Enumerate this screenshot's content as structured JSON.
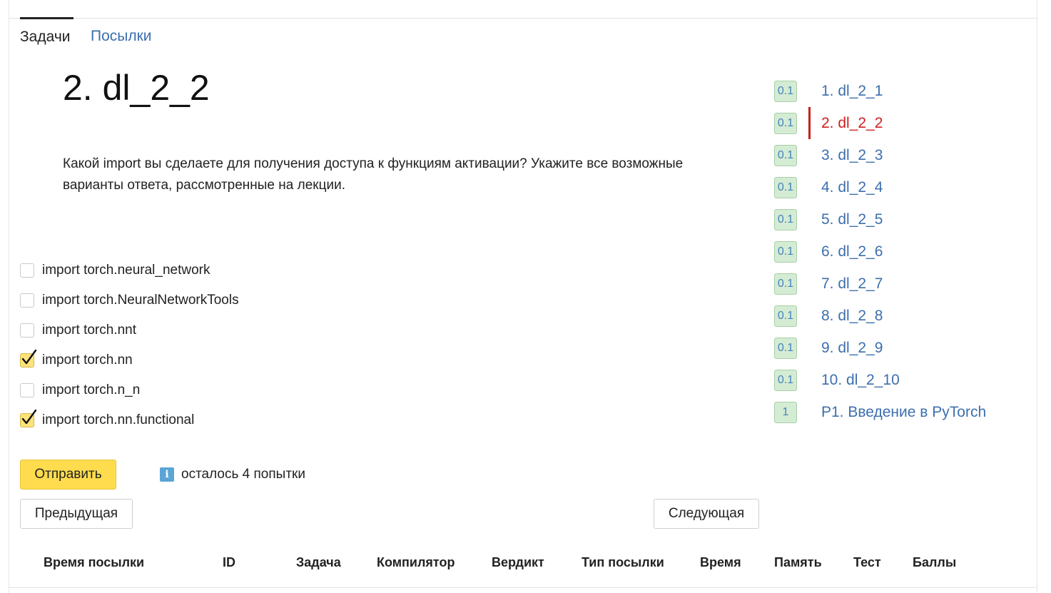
{
  "tabs": {
    "tasks": "Задачи",
    "submissions": "Посылки"
  },
  "task": {
    "title": "2. dl_2_2",
    "text": "Какой import вы сделаете для получения доступа к функциям активации? Укажите все возможные варианты ответа, рассмотренные на лекции."
  },
  "options": [
    {
      "label": "import torch.neural_network",
      "checked": false
    },
    {
      "label": "import torch.NeuralNetworkTools",
      "checked": false
    },
    {
      "label": "import torch.nnt",
      "checked": false
    },
    {
      "label": "import torch.nn",
      "checked": true
    },
    {
      "label": "import torch.n_n",
      "checked": false
    },
    {
      "label": "import torch.nn.functional",
      "checked": true
    }
  ],
  "buttons": {
    "submit": "Отправить",
    "prev": "Предыдущая",
    "next": "Следующая"
  },
  "attempts": {
    "icon": "i",
    "text": "осталось 4 попытки"
  },
  "sidebar": {
    "items": [
      {
        "score": "0.1",
        "label": "1. dl_2_1"
      },
      {
        "score": "0.1",
        "label": "2. dl_2_2",
        "active": true
      },
      {
        "score": "0.1",
        "label": "3. dl_2_3"
      },
      {
        "score": "0.1",
        "label": "4. dl_2_4"
      },
      {
        "score": "0.1",
        "label": "5. dl_2_5"
      },
      {
        "score": "0.1",
        "label": "6. dl_2_6"
      },
      {
        "score": "0.1",
        "label": "7. dl_2_7"
      },
      {
        "score": "0.1",
        "label": "8. dl_2_8"
      },
      {
        "score": "0.1",
        "label": "9. dl_2_9"
      },
      {
        "score": "0.1",
        "label": "10. dl_2_10"
      },
      {
        "score": "1",
        "label": "P1. Введение в PyTorch"
      }
    ]
  },
  "table": {
    "headers": [
      "Время посылки",
      "ID",
      "Задача",
      "Компилятор",
      "Вердикт",
      "Тип посылки",
      "Время",
      "Память",
      "Тест",
      "Баллы"
    ]
  },
  "colors": {
    "link": "#3d6fae",
    "active_link": "#d01f1f",
    "submit_bg": "#ffdc4d",
    "score_bg": "#d3ecd3",
    "checked_bg": "#ffe27a"
  }
}
